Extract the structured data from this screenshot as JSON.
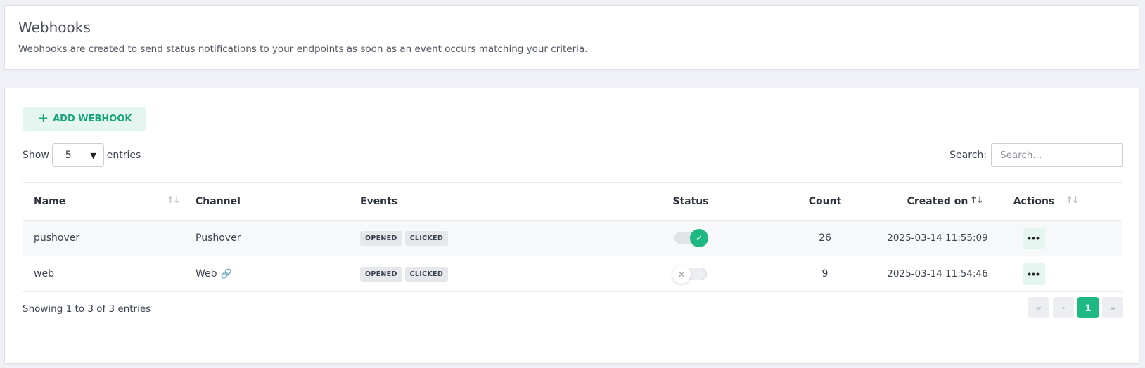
{
  "header": {
    "title": "Webhooks",
    "subtitle": "Webhooks are created to send status notifications to your endpoints as soon as an event occurs matching your criteria."
  },
  "toolbar": {
    "add_label": "ADD WEBHOOK",
    "show_label": "Show",
    "entries_value": "5",
    "entries_label": "entries",
    "search_label": "Search:",
    "search_placeholder": "Search..."
  },
  "table": {
    "columns": [
      "Name",
      "Channel",
      "Events",
      "Status",
      "Count",
      "Created on",
      "Actions"
    ],
    "rows": [
      {
        "name": "pushover",
        "channel": "Pushover",
        "events": [
          "OPENED",
          "CLICKED"
        ],
        "status": "on",
        "count": "26",
        "created": "2025-03-14 11:55:09"
      },
      {
        "name": "web",
        "channel": "Web",
        "events": [
          "OPENED",
          "CLICKED"
        ],
        "status": "off",
        "count": "9",
        "created": "2025-03-14 11:54:46"
      }
    ]
  },
  "footer": {
    "info": "Showing 1 to 3 of 3 entries",
    "current_page": "1"
  },
  "colors": {
    "accent": "#1eb883",
    "accent_light": "#e5f6f1"
  }
}
